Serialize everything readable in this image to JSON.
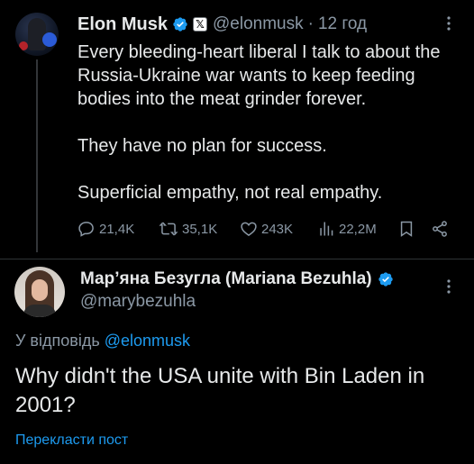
{
  "parent_tweet": {
    "author_name": "Elon Musk",
    "handle": "@elonmusk",
    "separator": "·",
    "time_ago": "12 год",
    "paragraphs": [
      "Every bleeding-heart liberal I talk to about the Russia-Ukraine war wants to keep feeding bodies into the meat grinder forever.",
      "They have no plan for success.",
      "Superficial empathy, not real empathy."
    ],
    "stats": {
      "replies": "21,4K",
      "reposts": "35,1K",
      "likes": "243K",
      "views": "22,2M"
    },
    "icons": [
      "verified-badge-icon",
      "x-affiliate-badge-icon",
      "more-icon",
      "reply-icon",
      "repost-icon",
      "like-icon",
      "views-icon",
      "bookmark-icon",
      "share-icon"
    ]
  },
  "reply": {
    "author_name": "Мар’яна Безугла (Mariana Bezuhla)",
    "handle": "@marybezuhla",
    "replying_prefix": "У відповідь",
    "replying_to": "@elonmusk",
    "text": "Why didn't the USA unite with Bin Laden in 2001?",
    "translate_label": "Перекласти пост"
  },
  "colors": {
    "background": "#000000",
    "text": "#e7e9ea",
    "muted": "#8b98a5",
    "accent": "#1d9bf0"
  }
}
